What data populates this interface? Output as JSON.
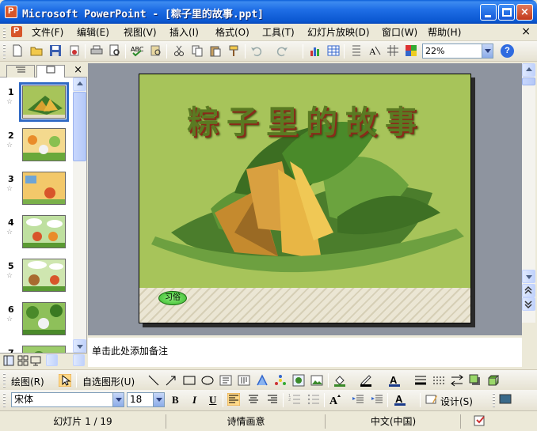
{
  "window": {
    "title": "Microsoft PowerPoint - [粽子里的故事.ppt]",
    "buttons": {
      "minimize": "minimize",
      "maximize": "maximize",
      "close": "×"
    }
  },
  "menu": {
    "items": [
      "文件(F)",
      "编辑(E)",
      "视图(V)",
      "插入(I)",
      "格式(O)",
      "工具(T)",
      "幻灯片放映(D)",
      "窗口(W)",
      "帮助(H)"
    ],
    "close": "×"
  },
  "standard_toolbar": {
    "zoom": "22%",
    "help": "?"
  },
  "left_pane": {
    "close": "×",
    "slides": [
      {
        "number": "1",
        "star": "☆"
      },
      {
        "number": "2",
        "star": "☆"
      },
      {
        "number": "3",
        "star": "☆"
      },
      {
        "number": "4",
        "star": "☆"
      },
      {
        "number": "5",
        "star": "☆"
      },
      {
        "number": "6",
        "star": "☆"
      },
      {
        "number": "7",
        "star": ""
      }
    ]
  },
  "slide": {
    "title": "粽子里的故事",
    "button_label": "习俗",
    "colors": {
      "background": "#a7c45a",
      "title": "#5a7a22"
    }
  },
  "notes": {
    "placeholder": "单击此处添加备注"
  },
  "drawing_toolbar": {
    "draw_label": "绘图(R)",
    "autoshapes_label": "自选图形(U)"
  },
  "format_toolbar": {
    "font": "宋体",
    "size": "18",
    "bold": "B",
    "italic": "I",
    "underline": "U",
    "design_label": "设计(S)"
  },
  "status": {
    "slide": "幻灯片 1 / 19",
    "template": "诗情画意",
    "language": "中文(中国)"
  }
}
